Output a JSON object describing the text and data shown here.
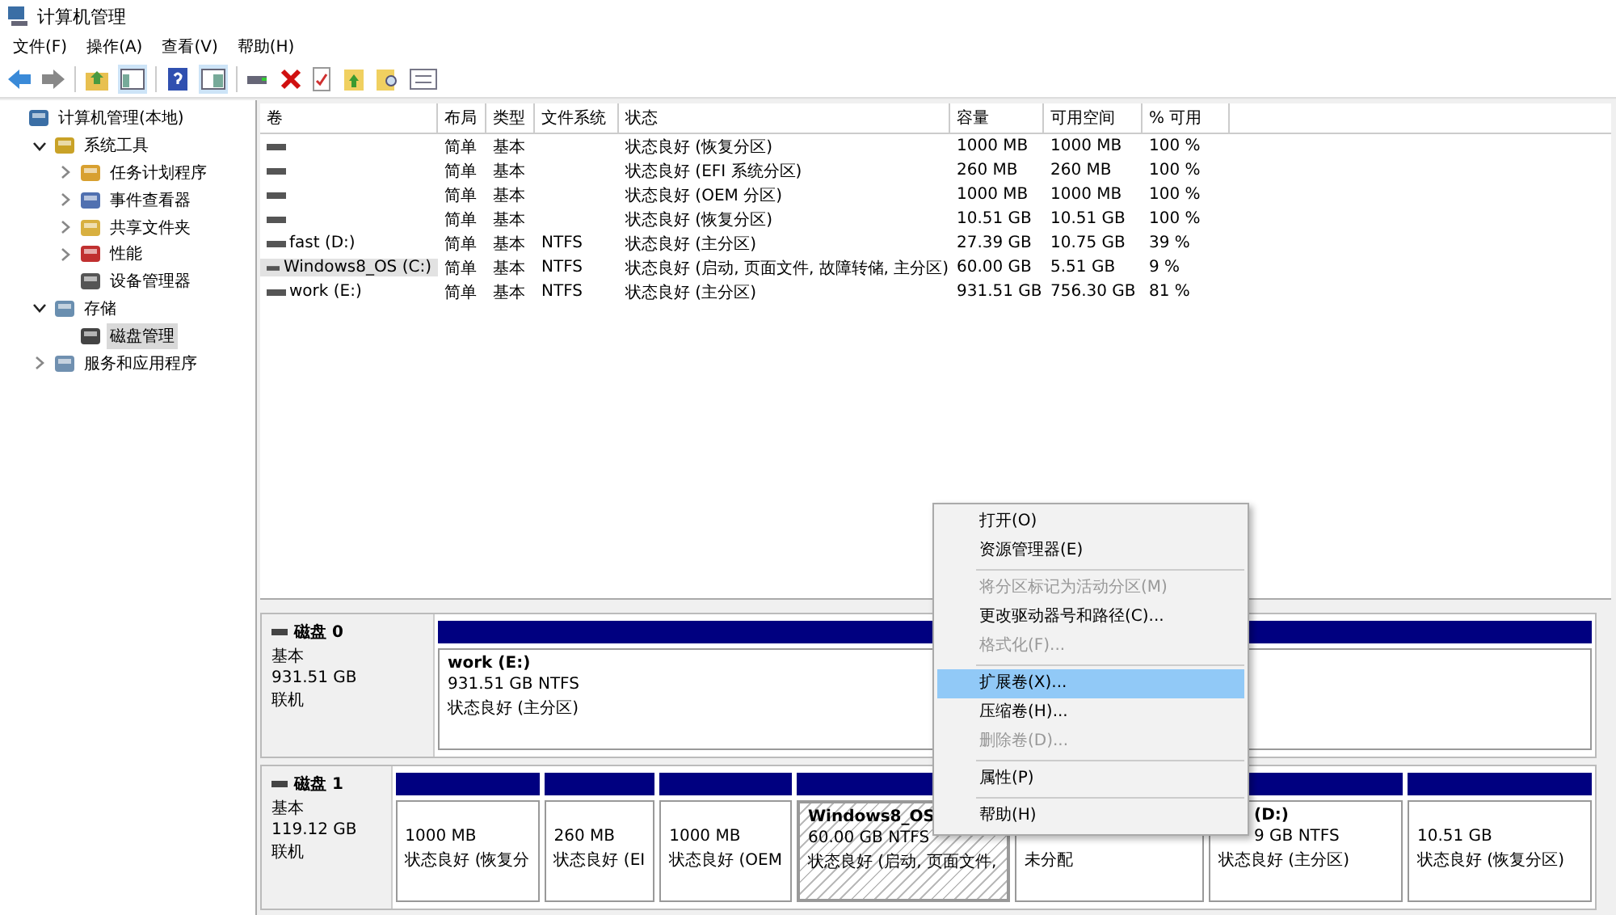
{
  "window": {
    "title": "计算机管理"
  },
  "menu_bar": [
    "文件(F)",
    "操作(A)",
    "查看(V)",
    "帮助(H)"
  ],
  "tree": [
    {
      "label": "计算机管理(本地)",
      "selected": false,
      "children": [
        {
          "label": "系统工具",
          "expanded": true,
          "selected": false,
          "children": [
            {
              "label": "任务计划程序",
              "expanded": false,
              "selected": false
            },
            {
              "label": "事件查看器",
              "expanded": false,
              "selected": false
            },
            {
              "label": "共享文件夹",
              "expanded": false,
              "selected": false
            },
            {
              "label": "性能",
              "expanded": false,
              "selected": false
            },
            {
              "label": "设备管理器",
              "selected": false
            }
          ]
        },
        {
          "label": "存储",
          "expanded": true,
          "selected": false,
          "children": [
            {
              "label": "磁盘管理",
              "selected": true
            }
          ]
        },
        {
          "label": "服务和应用程序",
          "expanded": false,
          "selected": false
        }
      ]
    }
  ],
  "volume_table": {
    "columns": [
      "卷",
      "布局",
      "类型",
      "文件系统",
      "状态",
      "容量",
      "可用空间",
      "% 可用"
    ],
    "rows": [
      {
        "selected": false,
        "cells": [
          "",
          "简单",
          "基本",
          "",
          "状态良好 (恢复分区)",
          "1000 MB",
          "1000 MB",
          "100 %"
        ]
      },
      {
        "selected": false,
        "cells": [
          "",
          "简单",
          "基本",
          "",
          "状态良好 (EFI 系统分区)",
          "260 MB",
          "260 MB",
          "100 %"
        ]
      },
      {
        "selected": false,
        "cells": [
          "",
          "简单",
          "基本",
          "",
          "状态良好 (OEM 分区)",
          "1000 MB",
          "1000 MB",
          "100 %"
        ]
      },
      {
        "selected": false,
        "cells": [
          "",
          "简单",
          "基本",
          "",
          "状态良好 (恢复分区)",
          "10.51 GB",
          "10.51 GB",
          "100 %"
        ]
      },
      {
        "selected": false,
        "cells": [
          "fast (D:)",
          "简单",
          "基本",
          "NTFS",
          "状态良好 (主分区)",
          "27.39 GB",
          "10.75 GB",
          "39 %"
        ]
      },
      {
        "selected": true,
        "cells": [
          "Windows8_OS (C:)",
          "简单",
          "基本",
          "NTFS",
          "状态良好 (启动, 页面文件, 故障转储, 主分区)",
          "60.00 GB",
          "5.51 GB",
          "9 %"
        ]
      },
      {
        "selected": false,
        "cells": [
          "work (E:)",
          "简单",
          "基本",
          "NTFS",
          "状态良好 (主分区)",
          "931.51 GB",
          "756.30 GB",
          "81 %"
        ]
      }
    ]
  },
  "disks": [
    {
      "name": "磁盘 0",
      "type": "基本",
      "size": "931.51 GB",
      "status": "联机",
      "partitions": [
        {
          "kind": "primary",
          "selected": false,
          "name": "work  (E:)",
          "size": "931.51 GB NTFS",
          "status": "状态良好 (主分区)"
        }
      ]
    },
    {
      "name": "磁盘 1",
      "type": "基本",
      "size": "119.12 GB",
      "status": "联机",
      "partitions": [
        {
          "kind": "primary",
          "selected": false,
          "size": "1000 MB",
          "status": "状态良好 (恢复分"
        },
        {
          "kind": "primary",
          "selected": false,
          "size": "260 MB",
          "status": "状态良好 (EI"
        },
        {
          "kind": "primary",
          "selected": false,
          "size": "1000 MB",
          "status": "状态良好 (OEM"
        },
        {
          "kind": "primary",
          "selected": true,
          "name": "Windows8_OS",
          "size": "60.00 GB NTFS",
          "status": "状态良好 (启动, 页面文件,"
        },
        {
          "kind": "unallocated",
          "selected": false,
          "status": "未分配"
        },
        {
          "kind": "primary",
          "selected": false,
          "name": "(D:)",
          "size": "9 GB NTFS",
          "status": "状态良好 (主分区)"
        },
        {
          "kind": "primary",
          "selected": false,
          "size": "10.51 GB",
          "status": "状态良好 (恢复分区)"
        }
      ]
    }
  ],
  "context_menu": [
    {
      "kind": "item",
      "label": "打开(O)",
      "disabled": false,
      "selected": false
    },
    {
      "kind": "item",
      "label": "资源管理器(E)",
      "disabled": false,
      "selected": false
    },
    {
      "kind": "separator"
    },
    {
      "kind": "item",
      "label": "将分区标记为活动分区(M)",
      "disabled": true,
      "selected": false
    },
    {
      "kind": "item",
      "label": "更改驱动器号和路径(C)...",
      "disabled": false,
      "selected": false
    },
    {
      "kind": "item",
      "label": "格式化(F)...",
      "disabled": true,
      "selected": false
    },
    {
      "kind": "separator"
    },
    {
      "kind": "item",
      "label": "扩展卷(X)...",
      "disabled": false,
      "selected": true
    },
    {
      "kind": "item",
      "label": "压缩卷(H)...",
      "disabled": false,
      "selected": false
    },
    {
      "kind": "item",
      "label": "删除卷(D)...",
      "disabled": true,
      "selected": false
    },
    {
      "kind": "separator"
    },
    {
      "kind": "item",
      "label": "属性(P)",
      "disabled": false,
      "selected": false
    },
    {
      "kind": "separator"
    },
    {
      "kind": "item",
      "label": "帮助(H)",
      "disabled": false,
      "selected": false
    }
  ]
}
